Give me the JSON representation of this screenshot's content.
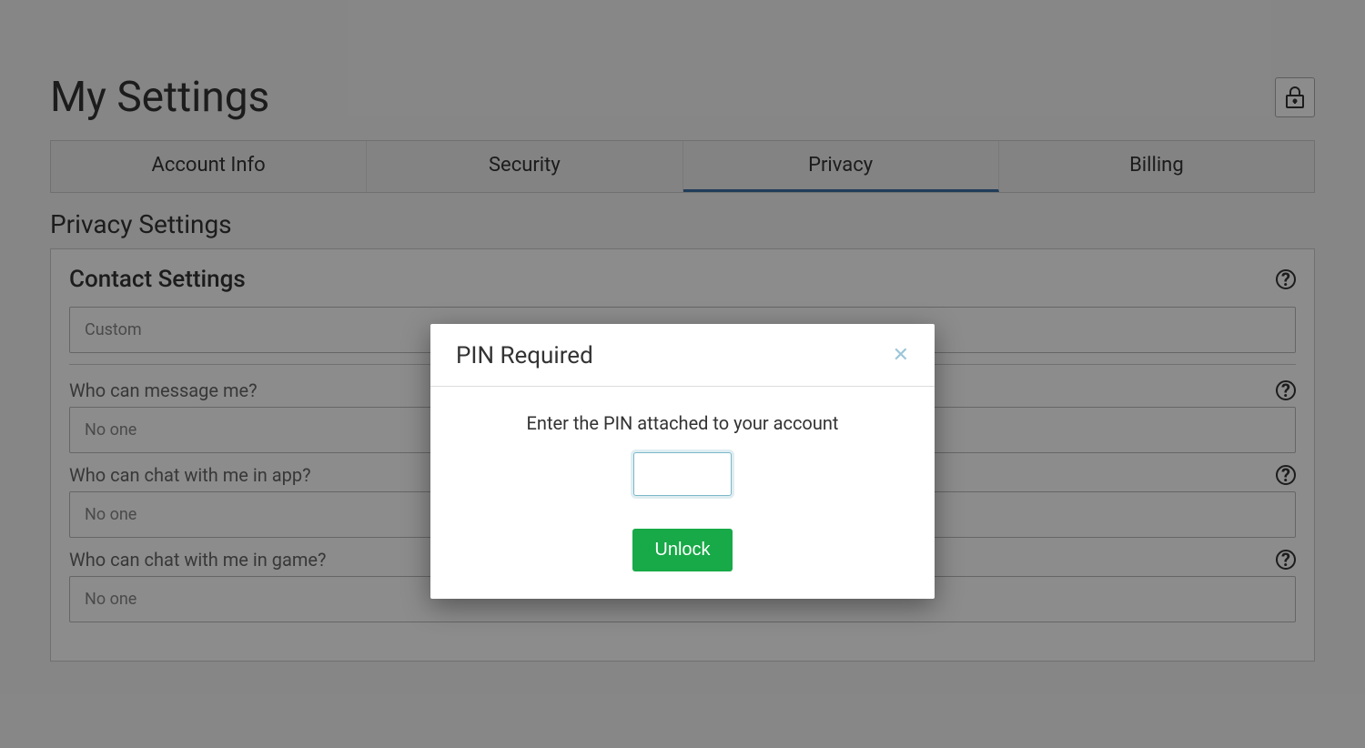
{
  "header": {
    "title": "My Settings"
  },
  "tabs": [
    {
      "label": "Account Info",
      "key": "account"
    },
    {
      "label": "Security",
      "key": "security"
    },
    {
      "label": "Privacy",
      "key": "privacy",
      "active": true
    },
    {
      "label": "Billing",
      "key": "billing"
    }
  ],
  "section": {
    "title": "Privacy Settings"
  },
  "panel": {
    "title": "Contact Settings",
    "preset_value": "Custom",
    "fields": [
      {
        "label": "Who can message me?",
        "value": "No one"
      },
      {
        "label": "Who can chat with me in app?",
        "value": "No one"
      },
      {
        "label": "Who can chat with me in game?",
        "value": "No one"
      }
    ]
  },
  "modal": {
    "title": "PIN Required",
    "message": "Enter the PIN attached to your account",
    "button": "Unlock"
  }
}
